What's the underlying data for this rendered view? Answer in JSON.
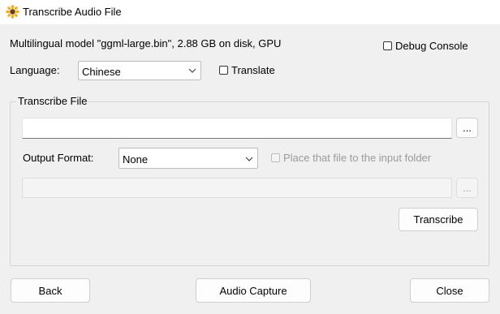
{
  "window": {
    "title": "Transcribe Audio File",
    "icon": "sunflower-icon"
  },
  "model_info": "Multilingual model \"ggml-large.bin\", 2.88 GB on disk, GPU",
  "debug_console": {
    "label": "Debug Console",
    "checked": false
  },
  "language": {
    "label": "Language:",
    "selected": "Chinese"
  },
  "translate": {
    "label": "Translate",
    "checked": false
  },
  "transcribe_group": {
    "title": "Transcribe File",
    "input_value": "",
    "browse_label": "...",
    "output_format": {
      "label": "Output Format:",
      "selected": "None"
    },
    "place_in_input_folder": {
      "label": "Place that file to the input folder",
      "checked": false,
      "enabled": false
    },
    "output_path_value": "",
    "output_browse_label": "...",
    "transcribe_button": "Transcribe"
  },
  "footer": {
    "back": "Back",
    "audio_capture": "Audio Capture",
    "close": "Close"
  }
}
